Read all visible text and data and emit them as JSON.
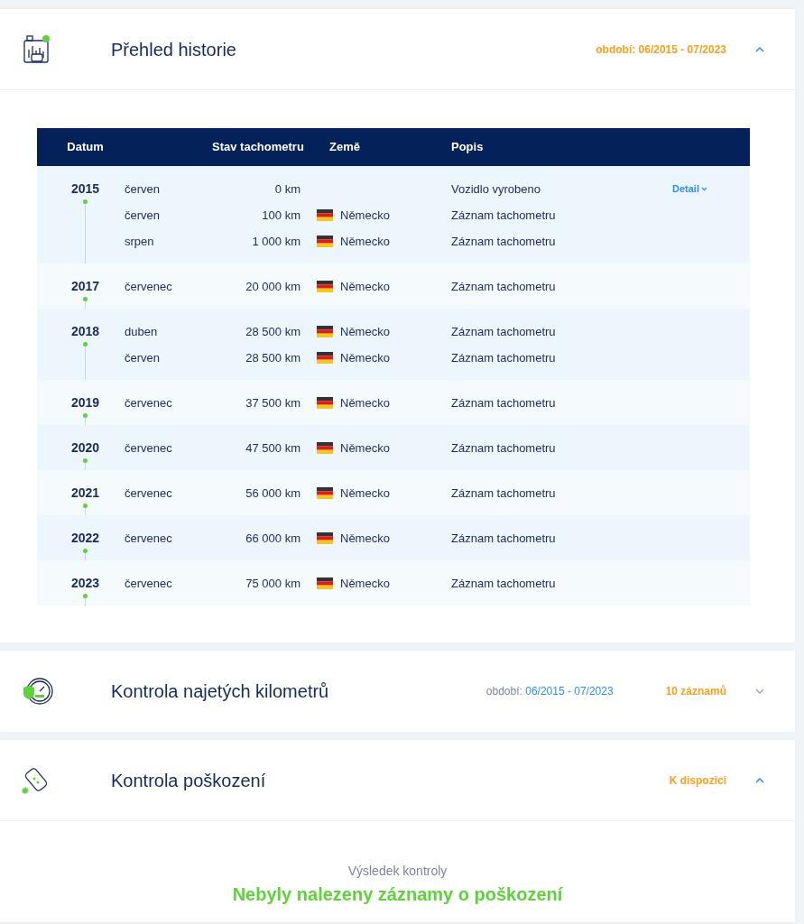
{
  "sections": [
    {
      "kind": "history",
      "title": "Přehled historie",
      "badge": "období: 06/2015 - 07/2023",
      "expanded": true,
      "table": {
        "columns": [
          "Datum",
          "Stav tachometru",
          "Země",
          "Popis"
        ],
        "groups": [
          {
            "year": "2015",
            "detail": "Detail",
            "entries": [
              {
                "month": "červen",
                "km": "0 km",
                "description": "Vozidlo vyrobeno"
              },
              {
                "month": "červen",
                "km": "100 km",
                "country": "Německo",
                "description": "Záznam tachometru"
              },
              {
                "month": "srpen",
                "km": "1 000 km",
                "country": "Německo",
                "description": "Záznam tachometru"
              }
            ]
          },
          {
            "year": "2017",
            "entries": [
              {
                "month": "červenec",
                "km": "20 000 km",
                "country": "Německo",
                "description": "Záznam tachometru"
              }
            ]
          },
          {
            "year": "2018",
            "entries": [
              {
                "month": "duben",
                "km": "28 500 km",
                "country": "Německo",
                "description": "Záznam tachometru"
              },
              {
                "month": "červen",
                "km": "28 500 km",
                "country": "Německo",
                "description": "Záznam tachometru"
              }
            ]
          },
          {
            "year": "2019",
            "entries": [
              {
                "month": "červenec",
                "km": "37 500 km",
                "country": "Německo",
                "description": "Záznam tachometru"
              }
            ]
          },
          {
            "year": "2020",
            "entries": [
              {
                "month": "červenec",
                "km": "47 500 km",
                "country": "Německo",
                "description": "Záznam tachometru"
              }
            ]
          },
          {
            "year": "2021",
            "entries": [
              {
                "month": "červenec",
                "km": "56 000 km",
                "country": "Německo",
                "description": "Záznam tachometru"
              }
            ]
          },
          {
            "year": "2022",
            "entries": [
              {
                "month": "červenec",
                "km": "66 000 km",
                "country": "Německo",
                "description": "Záznam tachometru"
              }
            ]
          },
          {
            "year": "2023",
            "entries": [
              {
                "month": "červenec",
                "km": "75 000 km",
                "country": "Německo",
                "description": "Záznam tachometru"
              }
            ]
          }
        ]
      }
    },
    {
      "kind": "mileage",
      "title": "Kontrola najetých kilometrů",
      "period_label": "období:",
      "period": "06/2015 - 07/2023",
      "badge": "10 záznamů",
      "expanded": false
    },
    {
      "kind": "damage",
      "title": "Kontrola poškození",
      "badge": "K dispozici",
      "expanded": true,
      "result": {
        "label": "Výsledek kontroly",
        "text": "Nebyly nalezeny záznamy o poškození"
      }
    }
  ]
}
